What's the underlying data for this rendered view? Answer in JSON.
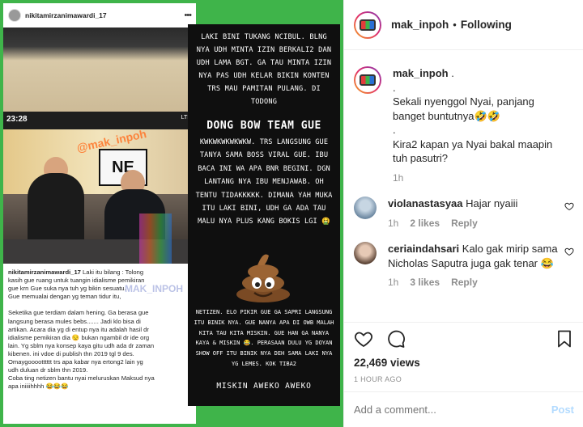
{
  "media": {
    "left_post": {
      "username": "nikitamirzanimawardi_17",
      "status_time": "23:28",
      "status_net": "LTE",
      "video_watermark": "@mak_inpoh",
      "board_text": "NE",
      "caption_watermark": "MAK_INPOH",
      "caption_user": "nikitamirzanimawardi_17",
      "caption_lines": [
        "Laki itu bilang : Tolong",
        "kasih gue ruang untuk tuangin idialisme pemikiran",
        "gue krn Gue suka nya tuh yg bikin sesuatu.",
        "Gue memualai dengan yg teman tidur itu,",
        "",
        "Seketika gue terdiam dalam hening. Ga berasa gue",
        "langsung berasa mules bebs....... Jadi klo bisa di",
        "artikan. Acara dia yg di entup nya itu adalah hasil dr",
        "idialisme pemikiran dia 😒 bukan ngambil dr ide org",
        "lain. Yg sblm nya konsep kaya gitu udh ada dr zaman",
        "kibenen. ini vdoe di publish thn 2019 tgl 9 des.",
        "Omaygooootttttt trs apa kabar nya ertong2 lain yg",
        "udh duluan dr sblm thn 2019.",
        "Coba ting netizen bantu nyai meluruskan Maksud nya",
        "apa iniiiihhhh 😂😂😂"
      ]
    },
    "story": {
      "para1": "LAKI BINI TUKANG NCIBUL. BLNG NYA UDH MINTA IZIN BERKALI2 DAN UDH LAMA BGT. GA TAU MINTA IZIN NYA PAS UDH KELAR BIKIN KONTEN TRS MAU PAMITAN PULANG. DI TODONG",
      "big_line": "DONG BOW TEAM GUE",
      "para2": "KWKWKWKWKWKW. TRS LANGSUNG GUE TANYA SAMA BOSS VIRAL GUE. IBU BACA INI WA APA BNR BEGINI. DGN LANTANG NYA IBU MENJAWAB. OH TENTU TIDAKKKKK. DIMANA YAH MUKA ITU LAKI BINI, UDH GA ADA TAU MALU NYA PLUS KANG BOKIS LGI 🤮",
      "para3": "NETIZEN. ELO PIKIR GUE GA SAPRI LANGSUNG ITU BINIK NYA. GUE NANYA APA DI OWB MALAH KITA TAU KITA MISKIN. GUE HAN GA NANYA KAYA & MISKIN 😂. PERASAAN DULU YG DOYAN SHOW OFF ITU BINIK NYA DEH SAMA LAKI NYA YG LEMES. KOK TIBA2",
      "para4": "MISKIN AWEKO AWEKO"
    }
  },
  "panel": {
    "header": {
      "username": "mak_inpoh",
      "separator": "•",
      "follow_status": "Following"
    },
    "caption": {
      "username": "mak_inpoh",
      "lines": [
        ".",
        ".",
        "Sekali nyenggol Nyai, panjang banget buntutnya🤣🤣",
        ".",
        "Kira2 kapan ya Nyai bakal maapin tuh pasutri?"
      ],
      "time": "1h"
    },
    "comments": [
      {
        "username": "violanastasyaa",
        "text": "Hajar nyaiii",
        "time": "1h",
        "likes": "2 likes",
        "reply": "Reply",
        "avatar_color": "#9bb2c7"
      },
      {
        "username": "ceriaindahsari",
        "text": "Kalo gak mirip sama Nicholas Saputra juga gak tenar 😂",
        "time": "1h",
        "likes": "3 likes",
        "reply": "Reply",
        "avatar_color": "#c9a892"
      }
    ],
    "views": "22,469 views",
    "posted_ago": "1 HOUR AGO",
    "add_comment_placeholder": "Add a comment...",
    "post_label": "Post"
  },
  "colors": {
    "background_green": "#3fb44a",
    "link_blue_disabled": "#b3dbff",
    "muted_gray": "#8e8e8e",
    "text_dark": "#262626"
  }
}
